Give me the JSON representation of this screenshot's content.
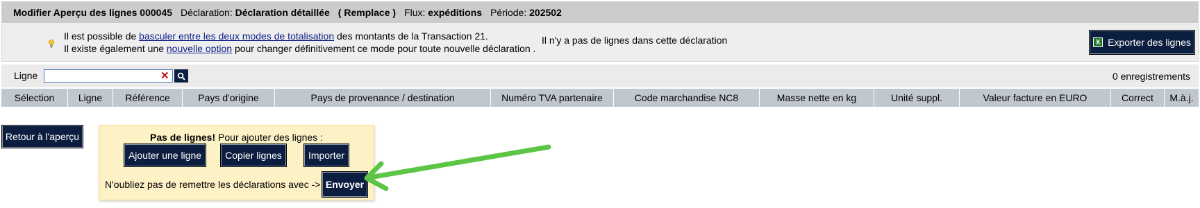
{
  "header": {
    "title": "Modifier Aperçu des lignes 000045",
    "declaration_label": "Déclaration",
    "declaration_value": "Déclaration détaillée",
    "mode_value": "( Remplace )",
    "flux_label": "Flux",
    "flux_value": "expéditions",
    "periode_label": "Période",
    "periode_value": "202502"
  },
  "info": {
    "line1_pre": "Il est possible de ",
    "line1_link": "basculer entre les deux modes de totalisation",
    "line1_post": " des montants de la Transaction 21.",
    "line2_pre": "Il existe également une ",
    "line2_link": "nouvelle option",
    "line2_post": " pour changer définitivement ce mode pour toute nouvelle déclaration .",
    "no_lines": "Il n'y a pas de lignes dans cette déclaration",
    "export_label": "Exporter des lignes"
  },
  "search": {
    "label": "Ligne",
    "value": "",
    "count_text": "0 enregistrements"
  },
  "table": {
    "columns": [
      "Sélection",
      "Ligne",
      "Référence",
      "Pays d'origine",
      "Pays de provenance / destination",
      "Numéro TVA partenaire",
      "Code marchandise NC8",
      "Masse nette en kg",
      "Unité suppl.",
      "Valeur facture en EURO",
      "Correct",
      "M.à.j."
    ]
  },
  "actions": {
    "back_label": "Retour à l'aperçu",
    "panel_title_bold": "Pas de lignes!",
    "panel_title_rest": " Pour ajouter des lignes :",
    "add_label": "Ajouter une ligne",
    "copy_label": "Copier lignes",
    "import_label": "Importer",
    "reminder_text": "N'oubliez pas de remettre les déclarations avec ->",
    "send_label": "Envoyer"
  },
  "colors": {
    "button_bg": "#0c1e3f",
    "title_bar_bg": "#cdcaca",
    "table_header_bg": "#c1c7ce",
    "panel_bg": "#fdf1c6",
    "arrow": "#5cc545"
  },
  "icons": {
    "bulb": "lightbulb-icon",
    "export": "excel-icon",
    "clear": "clear-icon",
    "search": "search-icon"
  }
}
